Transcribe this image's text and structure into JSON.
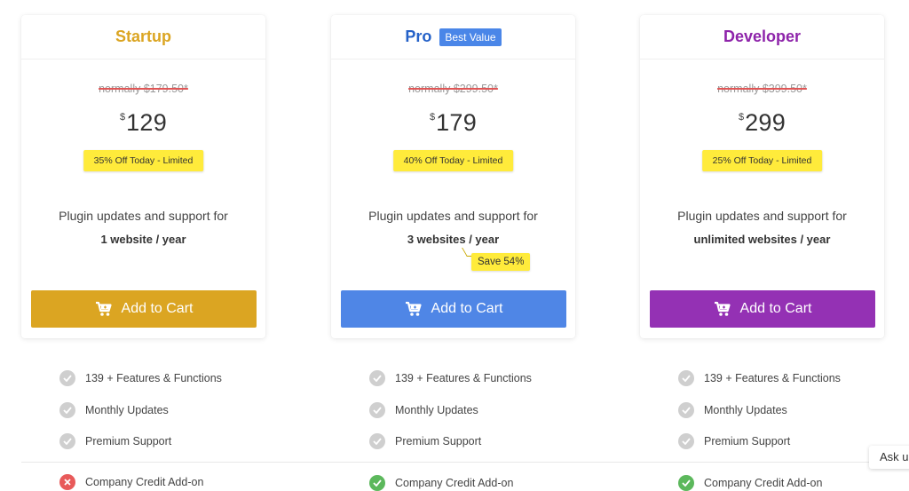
{
  "plans": [
    {
      "name": "Startup",
      "name_color": "#dba522",
      "badge": "",
      "old_price": "normally $179.50*",
      "currency": "$",
      "price": "129",
      "discount": "35% Off Today - Limited",
      "support_line": "Plugin updates and support for",
      "support_qty": "1 website / year",
      "save_tag": "",
      "button_label": "Add to Cart",
      "button_color": "#dba522",
      "features": [
        {
          "label": "139 + Features & Functions",
          "status": "included-grey"
        },
        {
          "label": "Monthly Updates",
          "status": "included-grey"
        },
        {
          "label": "Premium Support",
          "status": "included-grey"
        },
        {
          "label": "Company Credit Add-on",
          "status": "excluded"
        }
      ]
    },
    {
      "name": "Pro",
      "name_color": "#2461c8",
      "badge": "Best Value",
      "old_price": "normally $299.50*",
      "currency": "$",
      "price": "179",
      "discount": "40% Off Today - Limited",
      "support_line": "Plugin updates and support for",
      "support_qty": "3 websites / year",
      "save_tag": "Save 54%",
      "button_label": "Add to Cart",
      "button_color": "#4f86e6",
      "features": [
        {
          "label": "139 + Features & Functions",
          "status": "included-grey"
        },
        {
          "label": "Monthly Updates",
          "status": "included-grey"
        },
        {
          "label": "Premium Support",
          "status": "included-grey"
        },
        {
          "label": "Company Credit Add-on",
          "status": "included-green"
        }
      ]
    },
    {
      "name": "Developer",
      "name_color": "#8e24aa",
      "badge": "",
      "old_price": "normally $399.50*",
      "currency": "$",
      "price": "299",
      "discount": "25% Off Today - Limited",
      "support_line": "Plugin updates and support for",
      "support_qty": "unlimited websites / year",
      "save_tag": "",
      "button_label": "Add to Cart",
      "button_color": "#9431b4",
      "features": [
        {
          "label": "139 + Features & Functions",
          "status": "included-grey"
        },
        {
          "label": "Monthly Updates",
          "status": "included-grey"
        },
        {
          "label": "Premium Support",
          "status": "included-grey"
        },
        {
          "label": "Company Credit Add-on",
          "status": "included-green"
        }
      ]
    }
  ],
  "icons": {
    "cart": "shopping-cart-icon",
    "included_grey": "check-circle-grey-icon",
    "included_green": "check-circle-green-icon",
    "excluded": "x-circle-red-icon"
  },
  "colors": {
    "check_grey": "#cfcfcf",
    "check_green": "#5cb85c",
    "excluded_red": "#e85a5a"
  },
  "chat_widget": {
    "label": "Ask u"
  }
}
